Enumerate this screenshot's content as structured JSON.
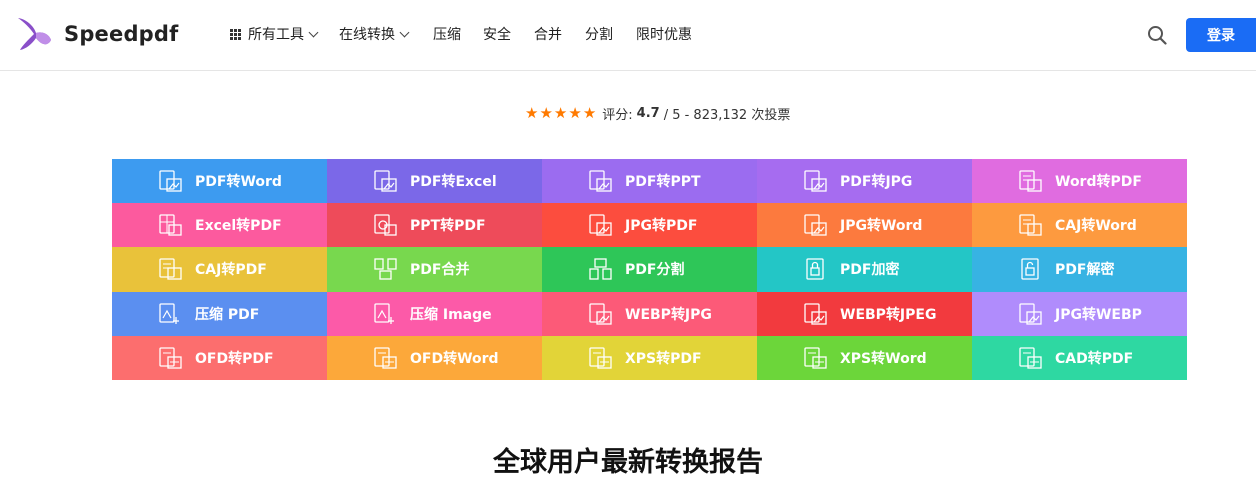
{
  "header": {
    "brand": "Speedpdf",
    "nav": [
      {
        "label": "所有工具",
        "icon": "grid-icon",
        "dropdown": true
      },
      {
        "label": "在线转换",
        "dropdown": true
      },
      {
        "label": "压缩"
      },
      {
        "label": "安全"
      },
      {
        "label": "合并"
      },
      {
        "label": "分割"
      },
      {
        "label": "限时优惠"
      }
    ],
    "login_label": "登录",
    "accent": "#1a6cf5"
  },
  "rating": {
    "stars": 5,
    "prefix": "评分:",
    "score": "4.7",
    "suffix": "/ 5 - 823,132 次投票"
  },
  "tools": [
    {
      "label": "PDF转Word",
      "color": "#3d9bf0",
      "icon": "image-doc-icon"
    },
    {
      "label": "PDF转Excel",
      "color": "#7b68e8",
      "icon": "image-doc-icon"
    },
    {
      "label": "PDF转PPT",
      "color": "#9b6cf0",
      "icon": "image-doc-icon"
    },
    {
      "label": "PDF转JPG",
      "color": "#a66cf0",
      "icon": "image-doc-icon"
    },
    {
      "label": "Word转PDF",
      "color": "#e06ce0",
      "icon": "doc-icon"
    },
    {
      "label": "Excel转PDF",
      "color": "#fc5a9e",
      "icon": "table-doc-icon"
    },
    {
      "label": "PPT转PDF",
      "color": "#ee4b5a",
      "icon": "ppt-doc-icon"
    },
    {
      "label": "JPG转PDF",
      "color": "#fc4d3e",
      "icon": "image-doc-icon"
    },
    {
      "label": "JPG转Word",
      "color": "#fc7a3e",
      "icon": "image-doc-icon"
    },
    {
      "label": "CAJ转Word",
      "color": "#fd9a3f",
      "icon": "doc-icon"
    },
    {
      "label": "CAJ转PDF",
      "color": "#e9c23a",
      "icon": "doc-icon"
    },
    {
      "label": "PDF合并",
      "color": "#78d84e",
      "icon": "merge-icon"
    },
    {
      "label": "PDF分割",
      "color": "#2ec658",
      "icon": "split-icon"
    },
    {
      "label": "PDF加密",
      "color": "#23c6c6",
      "icon": "lock-icon"
    },
    {
      "label": "PDF解密",
      "color": "#37b3e3",
      "icon": "unlock-icon"
    },
    {
      "label": "压缩 PDF",
      "color": "#5b8ff0",
      "icon": "compress-icon"
    },
    {
      "label": "压缩 Image",
      "color": "#fc5aa8",
      "icon": "compress-icon"
    },
    {
      "label": "WEBP转JPG",
      "color": "#fc5a78",
      "icon": "image-doc-icon"
    },
    {
      "label": "WEBP转JPEG",
      "color": "#f23a3e",
      "icon": "image-doc-icon"
    },
    {
      "label": "JPG转WEBP",
      "color": "#b08cfc",
      "icon": "image-doc-icon"
    },
    {
      "label": "OFD转PDF",
      "color": "#fc6e6e",
      "icon": "ofd-doc-icon"
    },
    {
      "label": "OFD转Word",
      "color": "#fca83a",
      "icon": "ofd-doc-icon"
    },
    {
      "label": "XPS转PDF",
      "color": "#e2d438",
      "icon": "xps-doc-icon"
    },
    {
      "label": "XPS转Word",
      "color": "#6cd63a",
      "icon": "xps-doc-icon"
    },
    {
      "label": "CAD转PDF",
      "color": "#2ed8a2",
      "icon": "cad-doc-icon"
    }
  ],
  "section_title": "全球用户最新转换报告"
}
